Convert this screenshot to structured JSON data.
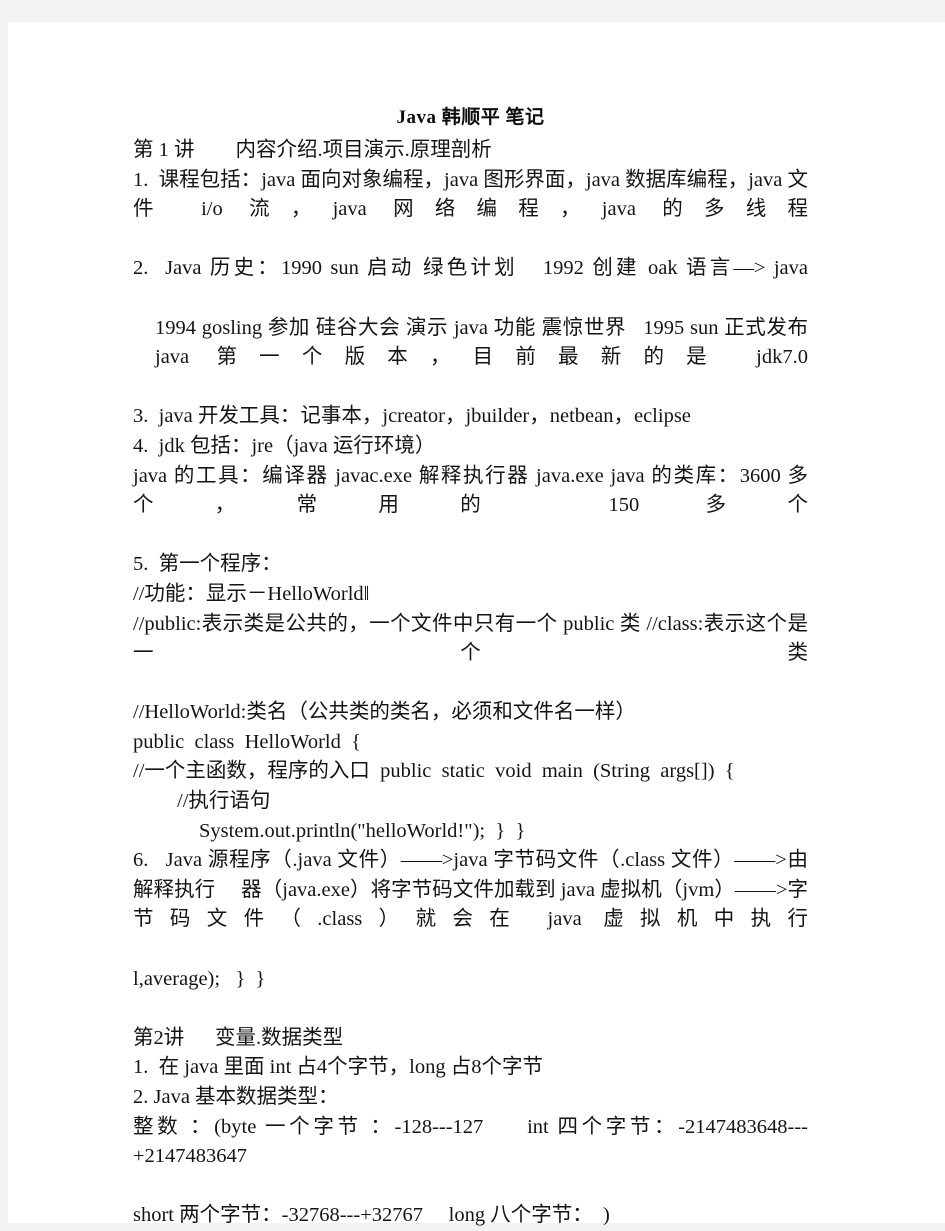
{
  "document": {
    "title": "Java 韩顺平 笔记",
    "lecture1": {
      "heading": "第 1 讲        内容介绍.项目演示.原理剖析",
      "items": [
        "1.  课程包括：java 面向对象编程，java 图形界面，java 数据库编程，java 文件 i/o 流，java 网络编程，java 的多线程",
        "2.  Java 历史：1990 sun 启动 绿色计划   1992 创建 oak 语言—> java",
        "1994 gosling 参加 硅谷大会 演示 java 功能 震惊世界   1995 sun 正式发布 java 第一个版本，目前最新的是 jdk7.0",
        "3.  java 开发工具：记事本，jcreator，jbuilder，netbean，eclipse",
        "4.  jdk 包括：jre（java 运行环境）",
        "java 的工具：编译器 javac.exe 解释执行器 java.exe java 的类库：3600 多个，常用的 150 多个",
        "5.  第一个程序："
      ],
      "code": {
        "comment_function": "//功能：显示－HelloWorld‖",
        "comment_public": "//public:表示类是公共的，一个文件中只有一个 public 类 //class:表示这个是一个类",
        "comment_helloworld": "//HelloWorld:类名（公共类的类名，必须和文件名一样）",
        "class_decl": "public  class  HelloWorld  {",
        "comment_main": "//一个主函数，程序的入口  public  static  void  main  (String  args[])  {",
        "comment_exec": "//执行语句",
        "println": "System.out.println(\"helloWorld!\");  }  }"
      },
      "item6": "6.   Java 源程序（.java 文件）——>java 字节码文件（.class 文件）——>由解释执行     器（java.exe）将字节码文件加载到 java 虚拟机（jvm）——>字节码文件（.class）就会在 java 虚拟机中执行",
      "trailing": "l,average);   }  }"
    },
    "lecture2": {
      "heading": "第2讲      变量.数据类型",
      "items": [
        "1.  在 java 里面 int 占4个字节，long 占8个字节",
        "2. Java 基本数据类型：",
        "整数 ：(byte 一个字节 ：-128---127     int 四个字节：-2147483648---+2147483647",
        "short 两个字节：-32768---+32767     long 八个字节：  )"
      ]
    }
  },
  "colors": {
    "page_background": "#ffffff",
    "canvas_background": "#f2f2f2",
    "text": "#141414"
  }
}
